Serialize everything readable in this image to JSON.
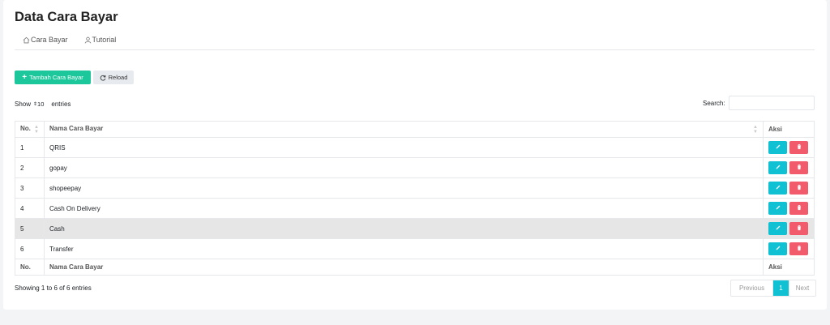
{
  "page": {
    "title": "Data Cara Bayar"
  },
  "breadcrumb": [
    {
      "label": "Cara Bayar",
      "icon": "home-icon"
    },
    {
      "label": "Tutorial",
      "icon": "user-icon"
    }
  ],
  "toolbar": {
    "add_label": "Tambah Cara Bayar",
    "reload_label": "Reload"
  },
  "length_control": {
    "show_label": "Show",
    "value": "10",
    "entries_label": "entries"
  },
  "search": {
    "label": "Search:",
    "value": ""
  },
  "table": {
    "headers": [
      "No.",
      "Nama Cara Bayar",
      "Aksi"
    ],
    "rows": [
      {
        "no": "1",
        "name": "QRIS"
      },
      {
        "no": "2",
        "name": "gopay"
      },
      {
        "no": "3",
        "name": "shopeepay"
      },
      {
        "no": "4",
        "name": "Cash On Delivery"
      },
      {
        "no": "5",
        "name": "Cash"
      },
      {
        "no": "6",
        "name": "Transfer"
      }
    ]
  },
  "footer": {
    "info": "Showing 1 to 6 of 6 entries",
    "pagination": {
      "prev": "Previous",
      "current": "1",
      "next": "Next"
    }
  },
  "colors": {
    "primary": "#1bc79b",
    "edit": "#10c1d3",
    "delete": "#f15b6c",
    "active_page": "#10c1d3"
  }
}
